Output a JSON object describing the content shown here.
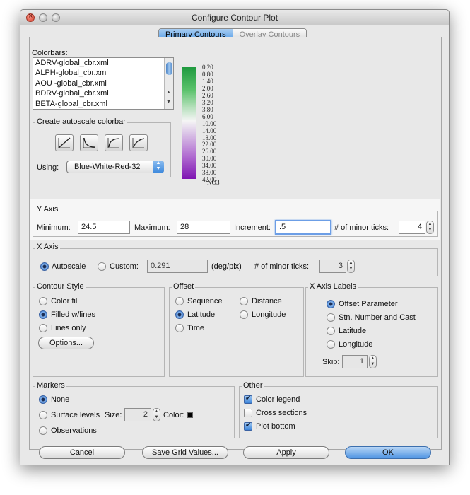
{
  "window": {
    "title": "Configure Contour Plot"
  },
  "tabs": [
    {
      "label": "Primary Contours",
      "active": true
    },
    {
      "label": "Overlay Contours",
      "active": false
    }
  ],
  "colorbars": {
    "label": "Colorbars:",
    "items": [
      "ADRV-global_cbr.xml",
      "ALPH-global_cbr.xml",
      "AOU -global_cbr.xml",
      "BDRV-global_cbr.xml",
      "BETA-global_cbr.xml"
    ],
    "scale_values": [
      "0.20",
      "0.80",
      "1.40",
      "2.00",
      "2.60",
      "3.20",
      "3.80",
      "6.00",
      "10.00",
      "14.00",
      "18.00",
      "22.00",
      "26.00",
      "30.00",
      "34.00",
      "38.00",
      "42.00"
    ],
    "variable": "NO3",
    "colors": {
      "top": "#1f9a3f",
      "middle": "#f5f5f5",
      "bottom": "#7f15b2"
    }
  },
  "autoscale": {
    "title": "Create autoscale colorbar",
    "icons": [
      "linear-curve-icon",
      "concave-curve-icon",
      "convex-curve-icon",
      "logarithmic-curve-icon"
    ],
    "using_label": "Using:",
    "using_value": "Blue-White-Red-32"
  },
  "y_axis": {
    "title": "Y Axis",
    "minimum_label": "Minimum:",
    "minimum": "24.5",
    "maximum_label": "Maximum:",
    "maximum": "28",
    "increment_label": "Increment:",
    "increment": ".5",
    "minor_ticks_label": "# of minor ticks:",
    "minor_ticks": "4"
  },
  "x_axis": {
    "title": "X Axis",
    "autoscale_label": "Autoscale",
    "autoscale_selected": true,
    "custom_label": "Custom:",
    "custom_value": "0.291",
    "units": "(deg/pix)",
    "minor_ticks_label": "# of minor ticks:",
    "minor_ticks": "3"
  },
  "contour_style": {
    "title": "Contour Style",
    "options": [
      "Color fill",
      "Filled w/lines",
      "Lines only"
    ],
    "selected": "Filled w/lines",
    "options_button": "Options..."
  },
  "offset": {
    "title": "Offset",
    "options": [
      "Sequence",
      "Distance",
      "Latitude",
      "Longitude",
      "Time"
    ],
    "selected": "Latitude"
  },
  "x_axis_labels": {
    "title": "X Axis Labels",
    "options": [
      "Offset Parameter",
      "Stn. Number and Cast",
      "Latitude",
      "Longitude"
    ],
    "selected": "Offset Parameter",
    "skip_label": "Skip:",
    "skip_value": "1"
  },
  "markers": {
    "title": "Markers",
    "none_label": "None",
    "surface_label": "Surface levels",
    "size_label": "Size:",
    "size_value": "2",
    "color_label": "Color:",
    "observations_label": "Observations",
    "selected": "None"
  },
  "other": {
    "title": "Other",
    "options": [
      "Color legend",
      "Cross sections",
      "Plot bottom"
    ],
    "checked": [
      true,
      false,
      true
    ]
  },
  "buttons": {
    "cancel": "Cancel",
    "save_grid": "Save Grid Values...",
    "apply": "Apply",
    "ok": "OK"
  }
}
